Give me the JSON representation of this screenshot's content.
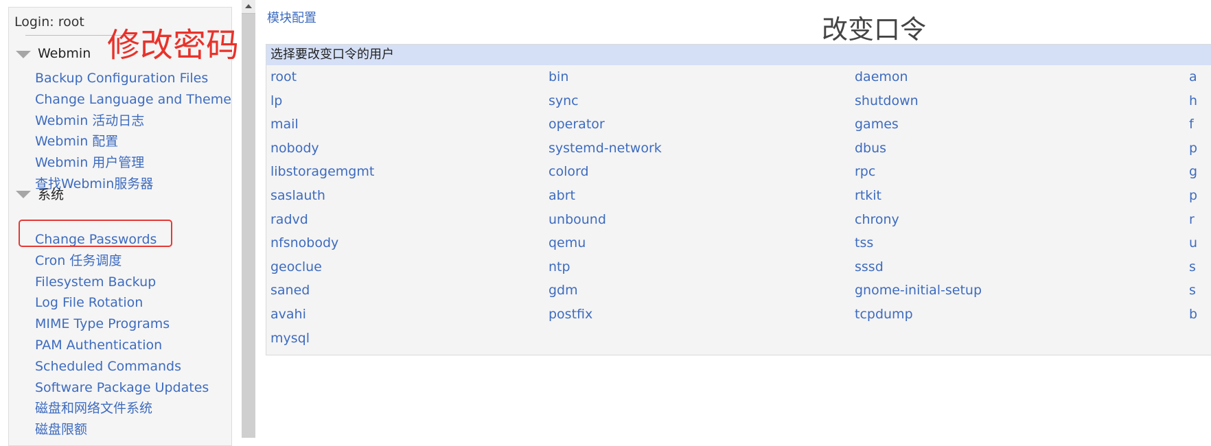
{
  "left_panel": {
    "login_label": "Login: root",
    "sections": [
      {
        "title": "Webmin",
        "items": [
          "Backup Configuration Files",
          "Change Language and Theme",
          "Webmin 活动日志",
          "Webmin 配置",
          "Webmin 用户管理",
          "查找Webmin服务器"
        ]
      },
      {
        "title": "系统",
        "items": [
          "Change Passwords",
          "Cron 任务调度",
          "Filesystem Backup",
          "Log File Rotation",
          "MIME Type Programs",
          "PAM Authentication",
          "Scheduled Commands",
          "Software Package Updates",
          "磁盘和网络文件系统",
          "磁盘限额"
        ]
      }
    ],
    "highlighted_item": "Change Passwords"
  },
  "annotation": {
    "text": "修改密码",
    "color": "#e8322a"
  },
  "main": {
    "module_config_link": "模块配置",
    "title": "改变口令",
    "table_header": "选择要改变口令的用户",
    "user_columns": [
      [
        "root",
        "lp",
        "mail",
        "nobody",
        "libstoragemgmt",
        "saslauth",
        "radvd",
        "nfsnobody",
        "geoclue",
        "saned",
        "avahi",
        "mysql"
      ],
      [
        "bin",
        "sync",
        "operator",
        "systemd-network",
        "colord",
        "abrt",
        "unbound",
        "qemu",
        "ntp",
        "gdm",
        "postfix"
      ],
      [
        "daemon",
        "shutdown",
        "games",
        "dbus",
        "rpc",
        "rtkit",
        "chrony",
        "tss",
        "sssd",
        "gnome-initial-setup",
        "tcpdump"
      ]
    ],
    "truncated_column_initials": [
      "a",
      "h",
      "f",
      "p",
      "g",
      "p",
      "r",
      "u",
      "s",
      "s",
      "b"
    ]
  },
  "colors": {
    "link": "#3d6bbf",
    "table_header_bg": "#d5e0f7",
    "highlight_border": "#e53935"
  }
}
